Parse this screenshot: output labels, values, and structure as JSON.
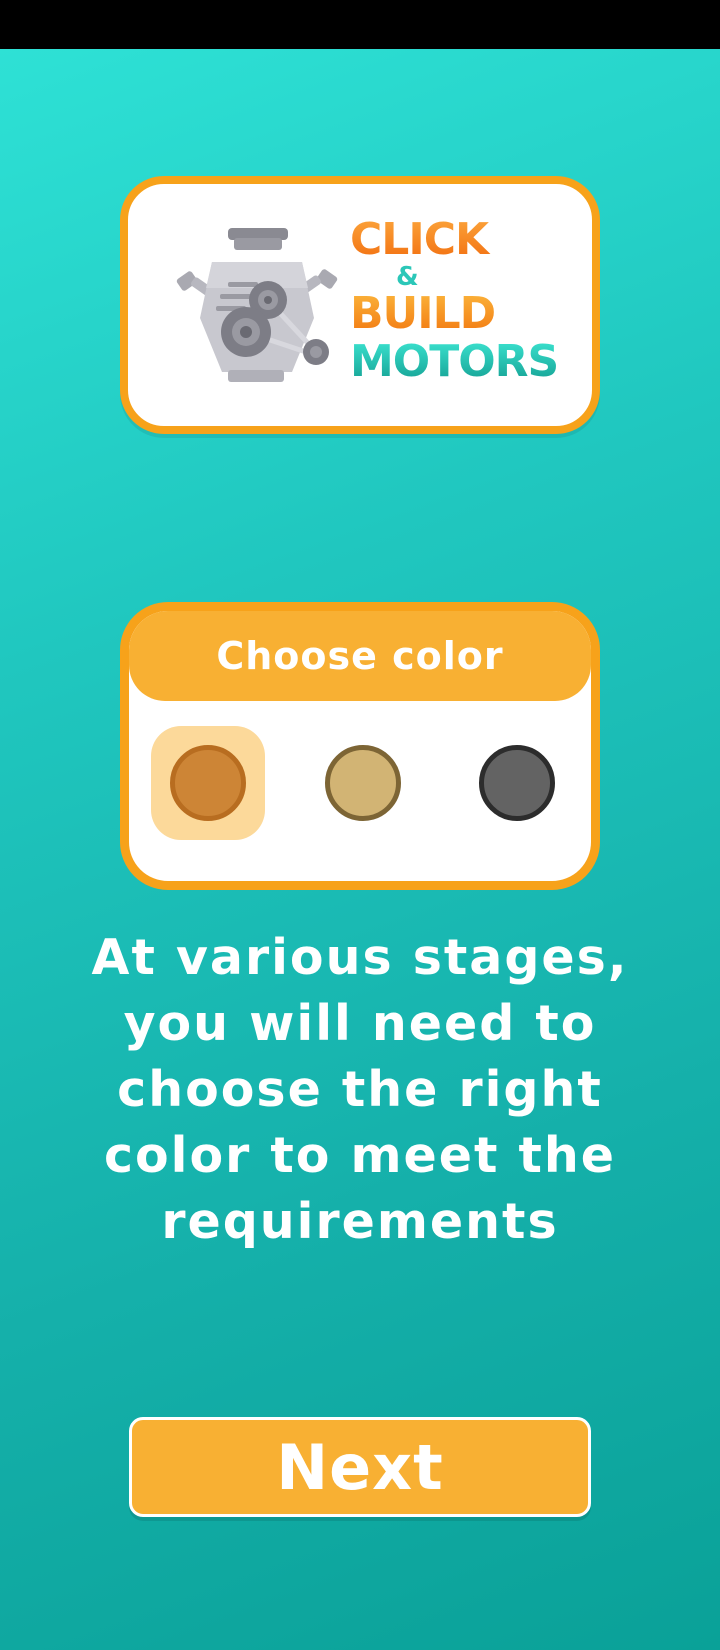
{
  "logo": {
    "line1": "CLICK",
    "line2": "&",
    "line3": "BUILD",
    "line4": "MOTORS",
    "icon": "engine-icon"
  },
  "color_picker": {
    "title": "Choose color",
    "selected_index": 0,
    "swatches": [
      {
        "fill": "#cd8536",
        "border": "#b86d20",
        "label": "orange-brown"
      },
      {
        "fill": "#d2b474",
        "border": "#7d6535",
        "label": "tan"
      },
      {
        "fill": "#636363",
        "border": "#2c2c2c",
        "label": "dark-gray"
      }
    ],
    "selected_highlight": "#fcd99a"
  },
  "instruction": {
    "text": "At various stages, you will need to choose the right color to meet the requirements"
  },
  "next_button": {
    "label": "Next"
  },
  "colors": {
    "accent_orange": "#f7a21a",
    "header_orange": "#f8b033",
    "background_teal": "#18b5ae"
  }
}
